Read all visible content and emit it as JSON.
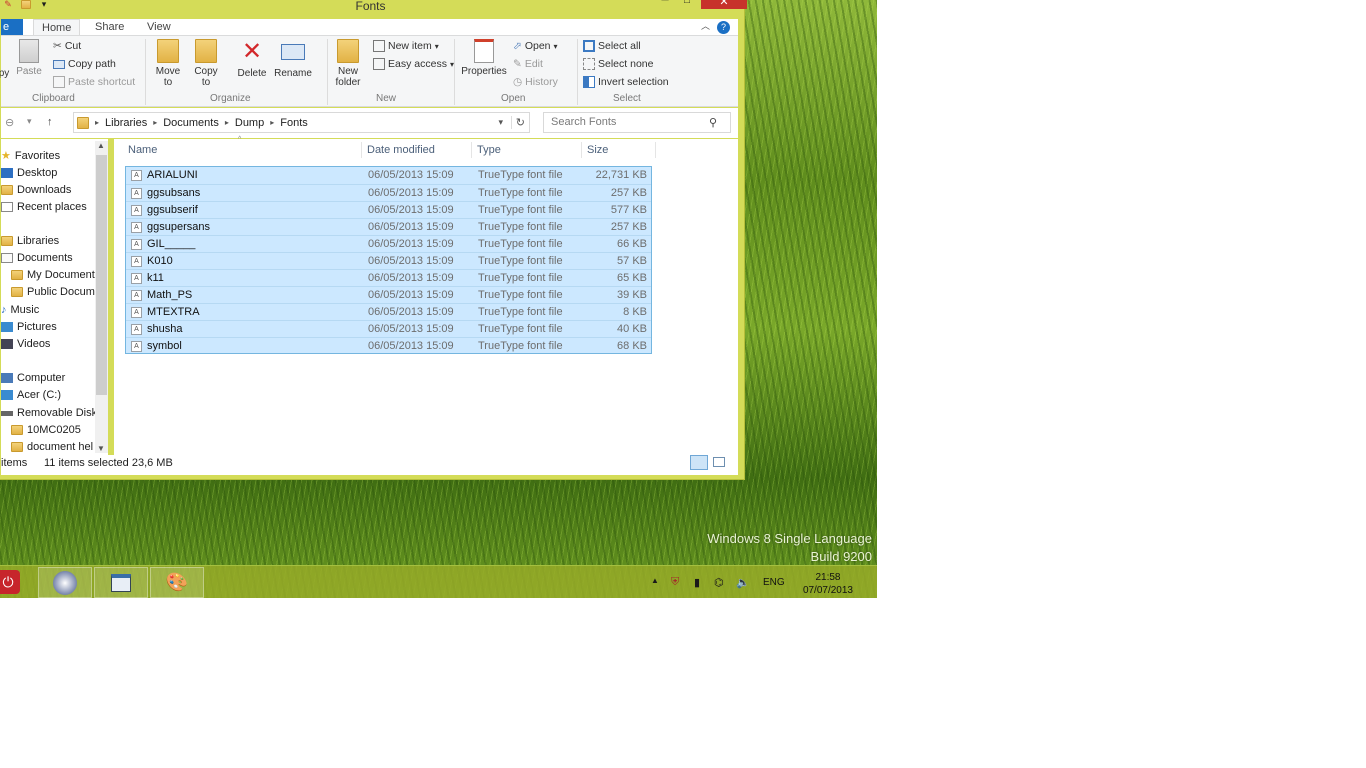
{
  "window": {
    "title": "Fonts",
    "close_glyph": "✕",
    "min_glyph": "─",
    "max_glyph": "□"
  },
  "ribbon_tabs": {
    "file": "e",
    "home": "Home",
    "share": "Share",
    "view": "View"
  },
  "ribbon": {
    "copy_partial": "py",
    "paste": "Paste",
    "cut": "Cut",
    "copy_path": "Copy path",
    "paste_shortcut": "Paste shortcut",
    "clipboard": "Clipboard",
    "move_to": "Move to",
    "copy_to": "Copy to",
    "delete": "Delete",
    "rename": "Rename",
    "organize": "Organize",
    "new_folder": "New folder",
    "new_item": "New item",
    "easy_access": "Easy access",
    "new": "New",
    "properties": "Properties",
    "open": "Open",
    "edit": "Edit",
    "history": "History",
    "open_group": "Open",
    "select_all": "Select all",
    "select_none": "Select none",
    "invert_selection": "Invert selection",
    "select_group": "Select"
  },
  "address": {
    "crumbs": [
      "Libraries",
      "Documents",
      "Dump",
      "Fonts"
    ],
    "search_placeholder": "Search Fonts"
  },
  "nav": {
    "favorites": "Favorites",
    "desktop": "Desktop",
    "downloads": "Downloads",
    "recent_places": "Recent places",
    "libraries": "Libraries",
    "documents": "Documents",
    "my_documents": "My Documents",
    "public_documents": "Public Docume",
    "music": "Music",
    "pictures": "Pictures",
    "videos": "Videos",
    "computer": "Computer",
    "acer": "Acer (C:)",
    "removable_disk": "Removable Disk (",
    "folder_10mc": "10MC0205",
    "document_help": "document hel"
  },
  "columns": {
    "name": "Name",
    "date_modified": "Date modified",
    "type": "Type",
    "size": "Size"
  },
  "files": [
    {
      "name": "ARIALUNI",
      "date": "06/05/2013 15:09",
      "type": "TrueType font file",
      "size": "22,731 KB"
    },
    {
      "name": "ggsubsans",
      "date": "06/05/2013 15:09",
      "type": "TrueType font file",
      "size": "257 KB"
    },
    {
      "name": "ggsubserif",
      "date": "06/05/2013 15:09",
      "type": "TrueType font file",
      "size": "577 KB"
    },
    {
      "name": "ggsupersans",
      "date": "06/05/2013 15:09",
      "type": "TrueType font file",
      "size": "257 KB"
    },
    {
      "name": "GIL_____",
      "date": "06/05/2013 15:09",
      "type": "TrueType font file",
      "size": "66 KB"
    },
    {
      "name": "K010",
      "date": "06/05/2013 15:09",
      "type": "TrueType font file",
      "size": "57 KB"
    },
    {
      "name": "k11",
      "date": "06/05/2013 15:09",
      "type": "TrueType font file",
      "size": "65 KB"
    },
    {
      "name": "Math_PS",
      "date": "06/05/2013 15:09",
      "type": "TrueType font file",
      "size": "39 KB"
    },
    {
      "name": "MTEXTRA",
      "date": "06/05/2013 15:09",
      "type": "TrueType font file",
      "size": "8 KB"
    },
    {
      "name": "shusha",
      "date": "06/05/2013 15:09",
      "type": "TrueType font file",
      "size": "40 KB"
    },
    {
      "name": "symbol",
      "date": "06/05/2013 15:09",
      "type": "TrueType font file",
      "size": "68 KB"
    }
  ],
  "status": {
    "items": "items",
    "selected": "11 items selected  23,6 MB"
  },
  "desktop": {
    "watermark_line1": "Windows 8 Single Language",
    "watermark_line2": "Build 9200"
  },
  "taskbar": {
    "lang": "ENG",
    "time": "21:58",
    "date": "07/07/2013"
  },
  "colors": {
    "window_frame": "#d4dc58",
    "selection": "#cce8ff",
    "file_tab": "#1a6fc4"
  }
}
